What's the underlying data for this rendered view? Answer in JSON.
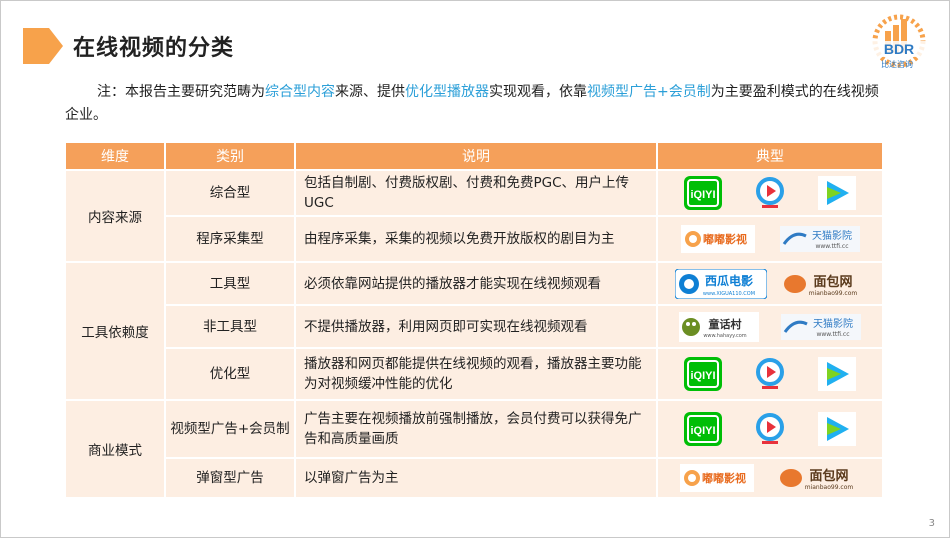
{
  "header": {
    "title": "在线视频的分类",
    "logo_text": "BDR",
    "logo_sub": "比达咨询"
  },
  "note": {
    "prefix": "注：本报告主要研究范畴为",
    "hl1": "综合型内容",
    "mid1": "来源、提供",
    "hl2": "优化型播放器",
    "mid2": "实现观看，依靠",
    "hl3": "视频型广告+会员制",
    "suffix": "为主要盈利模式的在线视频企业。"
  },
  "table": {
    "headers": [
      "维度",
      "类别",
      "说明",
      "典型"
    ],
    "groups": [
      "内容来源",
      "工具依赖度",
      "商业模式"
    ],
    "rows": [
      {
        "category": "综合型",
        "desc": "包括自制剧、付费版权剧、付费和免费PGC、用户上传UGC",
        "logos": [
          "iqiyi-logo",
          "youku-logo",
          "tencent-video-logo"
        ]
      },
      {
        "category": "程序采集型",
        "desc": "由程序采集，采集的视频以免费开放版权的剧目为主",
        "logos": [
          "yingshi-logo",
          "tianmao-yingyuan-logo"
        ]
      },
      {
        "category": "工具型",
        "desc": "必须依靠网站提供的播放器才能实现在线视频观看",
        "logos": [
          "xigua-logo",
          "mianbao-logo"
        ]
      },
      {
        "category": "非工具型",
        "desc": "不提供播放器，利用网页即可实现在线视频观看",
        "logos": [
          "tonghuacun-logo",
          "tianmao-yingyuan-logo"
        ]
      },
      {
        "category": "优化型",
        "desc": "播放器和网页都能提供在线视频的观看，播放器主要功能为对视频缓冲性能的优化",
        "logos": [
          "iqiyi-logo",
          "youku-logo",
          "tencent-video-logo"
        ]
      },
      {
        "category": "视频型广告+会员制",
        "desc": "广告主要在视频播放前强制播放，会员付费可以获得免广告和高质量画质",
        "logos": [
          "iqiyi-logo",
          "youku-logo",
          "tencent-video-logo"
        ]
      },
      {
        "category": "弹窗型广告",
        "desc": "以弹窗广告为主",
        "logos": [
          "yingshi-logo",
          "mianbao-logo"
        ]
      }
    ]
  },
  "logo_texts": {
    "iqiyi": "iQIYI",
    "xigua": "西瓜电影",
    "xigua_sub": "www.XIGUA110.COM",
    "mianbao": "面包网",
    "mianbao_sub": "mianbao99.com",
    "yingshi": "嘟嘟影视",
    "tianmao": "天猫影院",
    "tianmao_sub": "www.ttfi.cc",
    "tonghuacun": "童话村",
    "tonghuacun_sub": "www.hahayy.com"
  },
  "colors": {
    "header_bg": "#f5a05a",
    "cell_bg": "#fdeee2",
    "accent": "#f7a24b",
    "highlight_text": "#2b9fd8",
    "iqiyi_green": "#00be06"
  },
  "page_number": "3"
}
